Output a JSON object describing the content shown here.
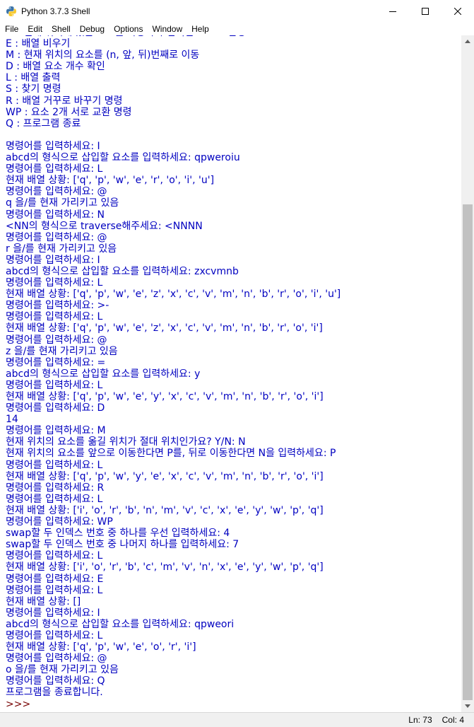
{
  "window": {
    "title": "Python 3.7.3 Shell",
    "icon": "python-icon",
    "controls": [
      "minimize-icon",
      "maximize-icon",
      "close-icon"
    ]
  },
  "menu": [
    "File",
    "Edit",
    "Shell",
    "Debug",
    "Options",
    "Window",
    "Help"
  ],
  "colors": {
    "stdout": "#0000c0",
    "prompt": "#770000",
    "background": "#ffffff"
  },
  "shell": {
    "lines": [
      {
        "text": "= : 현재 위치에 있는 요소를 사용자가 입력한 요소로 변경",
        "kind": "stdout"
      },
      {
        "text": "E : 배열 비우기",
        "kind": "stdout"
      },
      {
        "text": "M : 현재 위치의 요소를 (n, 앞, 뒤)번째로 이동",
        "kind": "stdout"
      },
      {
        "text": "D : 배열 요소 개수 확인",
        "kind": "stdout"
      },
      {
        "text": "L : 배열 출력",
        "kind": "stdout"
      },
      {
        "text": "S : 찾기 명령",
        "kind": "stdout"
      },
      {
        "text": "R : 배열 거꾸로 바꾸기 명령",
        "kind": "stdout"
      },
      {
        "text": "WP : 요소 2개 서로 교환 명령",
        "kind": "stdout"
      },
      {
        "text": "Q : 프로그램 종료",
        "kind": "stdout"
      },
      {
        "text": "",
        "kind": "stdout"
      },
      {
        "text": "명령어를 입력하세요: I",
        "kind": "stdout"
      },
      {
        "text": "abcd의 형식으로 삽입할 요소를 입력하세요: qpweroiu",
        "kind": "stdout"
      },
      {
        "text": "명령어를 입력하세요: L",
        "kind": "stdout"
      },
      {
        "text": "현재 배열 상황: ['q', 'p', 'w', 'e', 'r', 'o', 'i', 'u']",
        "kind": "stdout"
      },
      {
        "text": "명령어를 입력하세요: @",
        "kind": "stdout"
      },
      {
        "text": "q 을/를 현재 가리키고 있음",
        "kind": "stdout"
      },
      {
        "text": "명령어를 입력하세요: N",
        "kind": "stdout"
      },
      {
        "text": "<NN의 형식으로 traverse해주세요: <NNNN",
        "kind": "stdout"
      },
      {
        "text": "명령어를 입력하세요: @",
        "kind": "stdout"
      },
      {
        "text": "r 을/를 현재 가리키고 있음",
        "kind": "stdout"
      },
      {
        "text": "명령어를 입력하세요: I",
        "kind": "stdout"
      },
      {
        "text": "abcd의 형식으로 삽입할 요소를 입력하세요: zxcvmnb",
        "kind": "stdout"
      },
      {
        "text": "명령어를 입력하세요: L",
        "kind": "stdout"
      },
      {
        "text": "현재 배열 상황: ['q', 'p', 'w', 'e', 'z', 'x', 'c', 'v', 'm', 'n', 'b', 'r', 'o', 'i', 'u']",
        "kind": "stdout"
      },
      {
        "text": "명령어를 입력하세요: >-",
        "kind": "stdout"
      },
      {
        "text": "명령어를 입력하세요: L",
        "kind": "stdout"
      },
      {
        "text": "현재 배열 상황: ['q', 'p', 'w', 'e', 'z', 'x', 'c', 'v', 'm', 'n', 'b', 'r', 'o', 'i']",
        "kind": "stdout"
      },
      {
        "text": "명령어를 입력하세요: @",
        "kind": "stdout"
      },
      {
        "text": "z 을/를 현재 가리키고 있음",
        "kind": "stdout"
      },
      {
        "text": "명령어를 입력하세요: =",
        "kind": "stdout"
      },
      {
        "text": "abcd의 형식으로 삽입할 요소를 입력하세요: y",
        "kind": "stdout"
      },
      {
        "text": "명령어를 입력하세요: L",
        "kind": "stdout"
      },
      {
        "text": "현재 배열 상황: ['q', 'p', 'w', 'e', 'y', 'x', 'c', 'v', 'm', 'n', 'b', 'r', 'o', 'i']",
        "kind": "stdout"
      },
      {
        "text": "명령어를 입력하세요: D",
        "kind": "stdout"
      },
      {
        "text": "14",
        "kind": "stdout"
      },
      {
        "text": "명령어를 입력하세요: M",
        "kind": "stdout"
      },
      {
        "text": "현재 위치의 요소를 옮길 위치가 절대 위치인가요? Y/N: N",
        "kind": "stdout"
      },
      {
        "text": "현재 위치의 요소를 앞으로 이동한다면 P를, 뒤로 이동한다면 N을 입력하세요: P",
        "kind": "stdout"
      },
      {
        "text": "명령어를 입력하세요: L",
        "kind": "stdout"
      },
      {
        "text": "현재 배열 상황: ['q', 'p', 'w', 'y', 'e', 'x', 'c', 'v', 'm', 'n', 'b', 'r', 'o', 'i']",
        "kind": "stdout"
      },
      {
        "text": "명령어를 입력하세요: R",
        "kind": "stdout"
      },
      {
        "text": "명령어를 입력하세요: L",
        "kind": "stdout"
      },
      {
        "text": "현재 배열 상황: ['i', 'o', 'r', 'b', 'n', 'm', 'v', 'c', 'x', 'e', 'y', 'w', 'p', 'q']",
        "kind": "stdout"
      },
      {
        "text": "명령어를 입력하세요: WP",
        "kind": "stdout"
      },
      {
        "text": "swap할 두 인덱스 번호 중 하나를 우선 입력하세요: 4",
        "kind": "stdout"
      },
      {
        "text": "swap할 두 인덱스 번호 중 나머지 하나를 입력하세요: 7",
        "kind": "stdout"
      },
      {
        "text": "명령어를 입력하세요: L",
        "kind": "stdout"
      },
      {
        "text": "현재 배열 상황: ['i', 'o', 'r', 'b', 'c', 'm', 'v', 'n', 'x', 'e', 'y', 'w', 'p', 'q']",
        "kind": "stdout"
      },
      {
        "text": "명령어를 입력하세요: E",
        "kind": "stdout"
      },
      {
        "text": "명령어를 입력하세요: L",
        "kind": "stdout"
      },
      {
        "text": "현재 배열 상황: []",
        "kind": "stdout"
      },
      {
        "text": "명령어를 입력하세요: I",
        "kind": "stdout"
      },
      {
        "text": "abcd의 형식으로 삽입할 요소를 입력하세요: qpweori",
        "kind": "stdout"
      },
      {
        "text": "명령어를 입력하세요: L",
        "kind": "stdout"
      },
      {
        "text": "현재 배열 상황: ['q', 'p', 'w', 'e', 'o', 'r', 'i']",
        "kind": "stdout"
      },
      {
        "text": "명령어를 입력하세요: @",
        "kind": "stdout"
      },
      {
        "text": "o 을/를 현재 가리키고 있음",
        "kind": "stdout"
      },
      {
        "text": "명령어를 입력하세요: Q",
        "kind": "stdout"
      },
      {
        "text": "프로그램을 종료합니다.",
        "kind": "stdout"
      },
      {
        "text": ">>> ",
        "kind": "prompt"
      }
    ]
  },
  "scrollbar": {
    "position": 0.24,
    "visible_fraction": 0.76
  },
  "status": {
    "line": "Ln: 73",
    "col": "Col: 4"
  }
}
